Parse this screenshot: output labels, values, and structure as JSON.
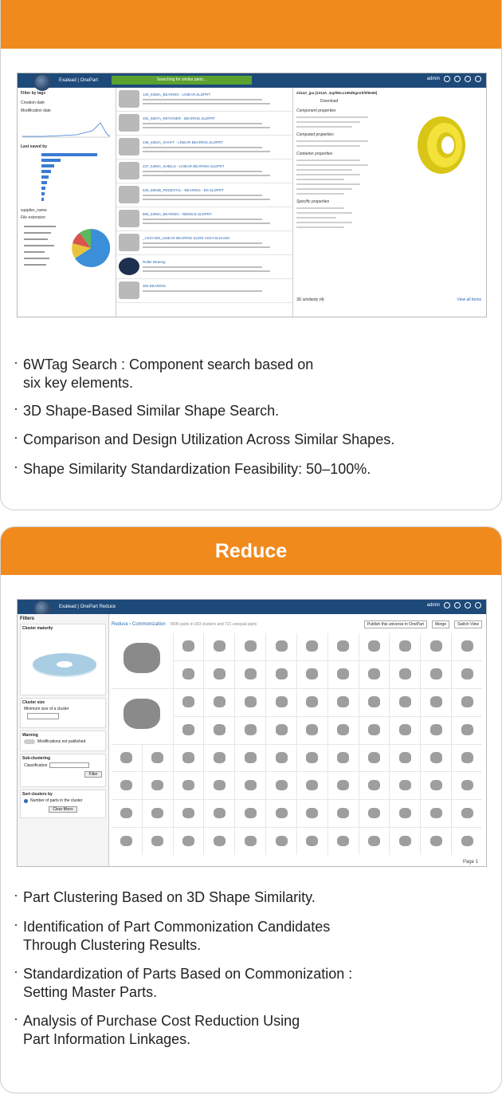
{
  "search_card": {
    "screenshot": {
      "app_title": "Exalead | OnePart",
      "search_status": "Searching for similar parts...",
      "user": "admin",
      "left_panel": {
        "filter_title": "Filter by tags",
        "creation_date": "Creation date",
        "modification_date": "Modification date",
        "last_saved_by": "Last saved by",
        "supplier_name": "supplier_name",
        "file_extension": "File extension"
      },
      "results": [
        "130_5369A_BEARING - LINEAR.SLDPRT",
        "482_6807A_RETAINER - BEARING.SLDPRT",
        "236_4662A_SHAFT - LINEAR BEARING.SLDPRT",
        "237_6480A_SHIELD - LINEAR BEARING.SLDPRT",
        "530_5804B_PEDESTAL - BEARING - BS.SLDPRT",
        "880_5369A_BEARING - NEEDLE.SLDPRT",
        "_ASSY400_LINEAR BEARING SLIDE ASSY.SLDASM",
        "Roller Bearing",
        "300 BEARING"
      ],
      "detail_title": "2314A_jpa [2314A_4apf9bcc196dbgmrkf0f9e69]",
      "download": "Download",
      "sections": [
        "Component properties",
        "Computed properties",
        "Container properties",
        "Specific properties"
      ],
      "similarity": "3D similarity (4)",
      "view_all": "View all items"
    },
    "bullets": [
      [
        "6WTag Search : Component search based on",
        "six key elements."
      ],
      [
        "3D Shape-Based Similar Shape Search."
      ],
      [
        "Comparison and Design Utilization Across Similar Shapes."
      ],
      [
        "Shape Similarity Standardization Feasibility: 50–100%."
      ]
    ]
  },
  "reduce_card": {
    "title": "Reduce",
    "screenshot": {
      "app_title": "Exalead | OnePart Reduce",
      "user": "admin",
      "filters_title": "Filters",
      "cluster_maturity": "Cluster maturity",
      "cluster_size": "Cluster size",
      "min_size_label": "Minimum size of a cluster",
      "warning": "Warning",
      "modifications": "Modifications not published",
      "sub_clustering": "Sub-clustering",
      "classification": "Classification",
      "filter_button": "Filter",
      "sort_clusters": "Sort clusters by",
      "sort_option": "Number of parts in the cluster",
      "clear_filters": "Clear filters",
      "breadcrumb": "Reduce › Commonization",
      "summary": "5595 parts in 933 clusters and 721 unequal parts",
      "publish_button": "Publish this universe in OnePart",
      "merge_button": "Merge",
      "switch_view_button": "Switch View",
      "pagination": "Page 1"
    },
    "bullets": [
      [
        "Part Clustering Based on 3D Shape Similarity."
      ],
      [
        "Identification of Part Commonization Candidates",
        "Through Clustering Results."
      ],
      [
        "Standardization of Parts Based on Commonization :",
        "Setting Master Parts."
      ],
      [
        "Analysis of Purchase Cost Reduction Using",
        "Part Information Linkages."
      ]
    ]
  }
}
